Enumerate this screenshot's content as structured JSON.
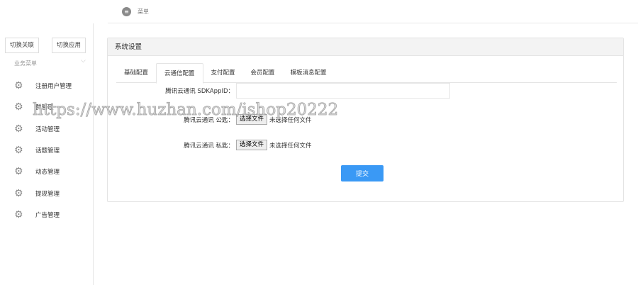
{
  "topbar": {
    "menu_label": "菜单"
  },
  "sidebar": {
    "switch_buttons": [
      "切换关联",
      "切换应用"
    ],
    "group_label": "业务菜单",
    "items": [
      {
        "label": "注册用户管理"
      },
      {
        "label": "群管理"
      },
      {
        "label": "活动管理"
      },
      {
        "label": "话题管理"
      },
      {
        "label": "动态管理"
      },
      {
        "label": "提现管理"
      },
      {
        "label": "广告管理"
      }
    ]
  },
  "panel": {
    "title": "系统设置",
    "tabs": [
      {
        "label": "基础配置"
      },
      {
        "label": "云通信配置",
        "active": true
      },
      {
        "label": "支付配置"
      },
      {
        "label": "会员配置"
      },
      {
        "label": "模板消息配置"
      }
    ],
    "form": {
      "sdk_label": "腾讯云通讯 SDKAppID：",
      "sdk_value": "",
      "pubkey_label": "腾讯云通讯 公匙：",
      "privkey_label": "腾讯云通讯 私匙：",
      "choose_file": "选择文件",
      "no_file": "未选择任何文件",
      "submit": "提交"
    }
  },
  "watermark": "https://www.huzhan.com/ishop20222"
}
